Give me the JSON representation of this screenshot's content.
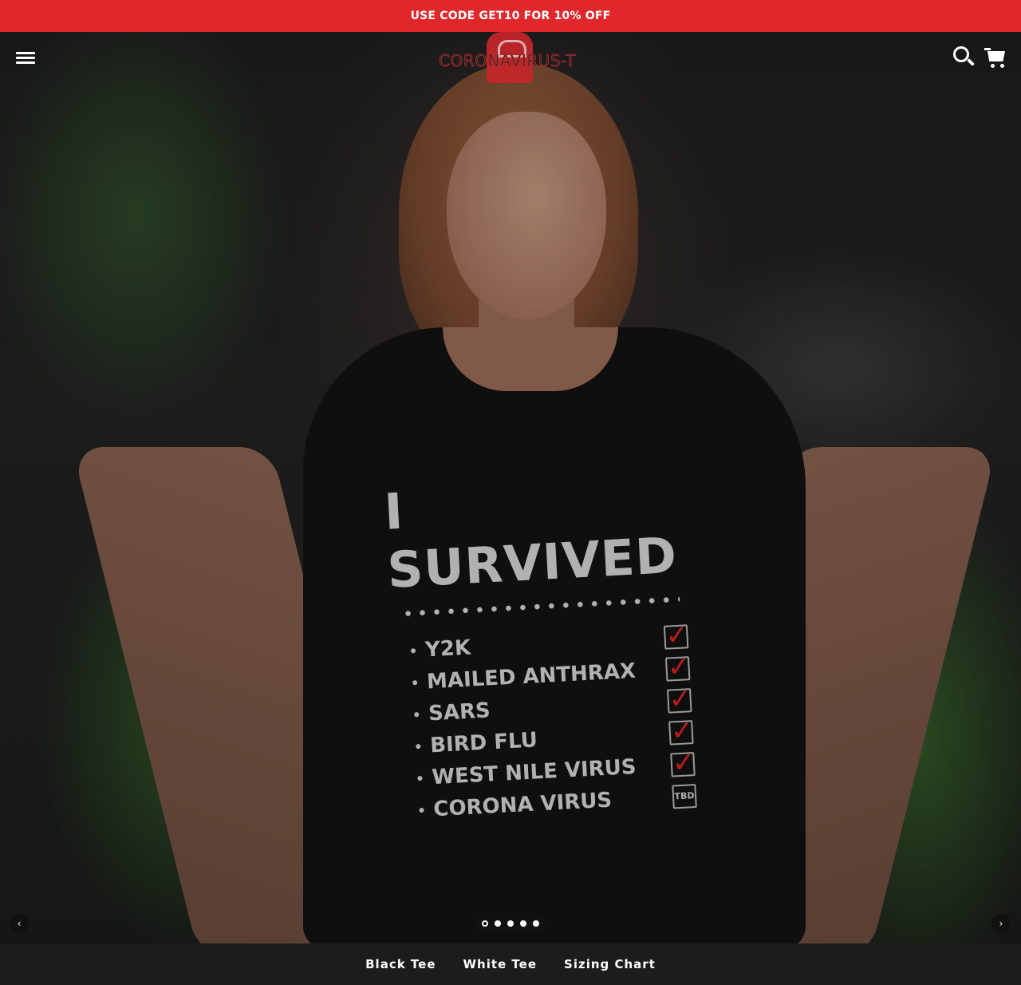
{
  "announcement": {
    "text": "USE CODE GET10 FOR 10% OFF"
  },
  "header": {
    "logo_text": "CORONAVIRUS-T",
    "menu_icon": "hamburger-menu-icon",
    "search_icon": "search-icon",
    "cart_icon": "cart-icon"
  },
  "hero": {
    "shirt_print": {
      "title": "I SURVIVED",
      "items": [
        {
          "label": "Y2K",
          "status": "check"
        },
        {
          "label": "MAILED ANTHRAX",
          "status": "check"
        },
        {
          "label": "SARS",
          "status": "check"
        },
        {
          "label": "BIRD FLU",
          "status": "check"
        },
        {
          "label": "WEST NILE VIRUS",
          "status": "check"
        },
        {
          "label": "CORONA VIRUS",
          "status": "TBD"
        }
      ],
      "check_glyph": "✓",
      "tbd_label": "TBD"
    },
    "slideshow": {
      "prev_glyph": "‹",
      "next_glyph": "›",
      "slide_count": 5,
      "active_slide": 1
    }
  },
  "footer_nav": {
    "links": [
      "Black Tee",
      "White Tee",
      "Sizing Chart"
    ]
  },
  "colors": {
    "accent": "#e0282c",
    "nav_bg": "#1c1c1c"
  }
}
